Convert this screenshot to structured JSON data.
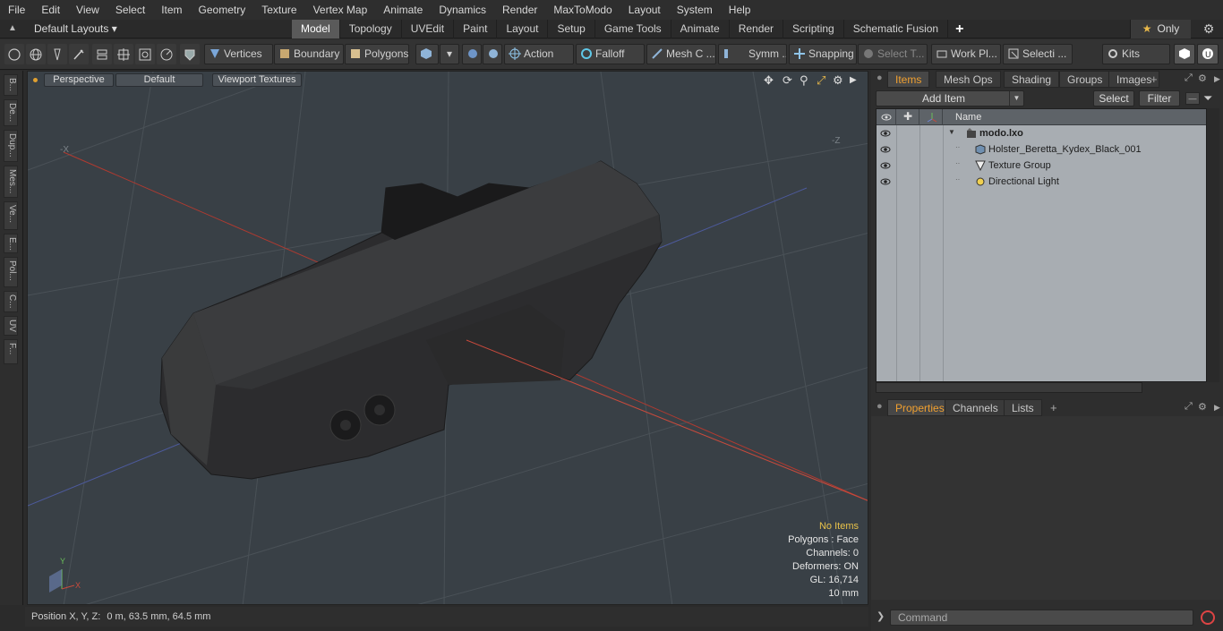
{
  "menu": [
    "File",
    "Edit",
    "View",
    "Select",
    "Item",
    "Geometry",
    "Texture",
    "Vertex Map",
    "Animate",
    "Dynamics",
    "Render",
    "MaxToModo",
    "Layout",
    "System",
    "Help"
  ],
  "layoutbar": {
    "layouts_label": "Default Layouts",
    "tabs": [
      "Model",
      "Topology",
      "UVEdit",
      "Paint",
      "Layout",
      "Setup",
      "Game Tools",
      "Animate",
      "Render",
      "Scripting",
      "Schematic Fusion"
    ],
    "active_tab": "Model",
    "only_label": "Only"
  },
  "toolbar": {
    "vertices": "Vertices",
    "boundary": "Boundary",
    "polygons": "Polygons",
    "action": "Action",
    "falloff": "Falloff",
    "mesh_c": "Mesh C ...",
    "symm": "Symm ...",
    "snapping": "Snapping",
    "select_t": "Select T...",
    "work_pl": "Work Pl...",
    "selecti": "Selecti ...",
    "kits": "Kits"
  },
  "leftstrip": [
    "B...",
    "De...",
    "Dup...",
    "Mes...",
    "Ve...",
    "E...",
    "Pol...",
    "C...",
    "UV",
    "F..."
  ],
  "viewport": {
    "perspective": "Perspective",
    "default": "Default",
    "textures": "Viewport Textures",
    "axis_neg_x": "-X",
    "axis_neg_z": "-Z",
    "stats": {
      "no_items": "No Items",
      "polygons": "Polygons : Face",
      "channels": "Channels: 0",
      "deformers": "Deformers: ON",
      "gl": "GL: 16,714",
      "scale": "10 mm"
    },
    "gizmo_y": "Y",
    "gizmo_x": "X"
  },
  "status": {
    "label": "Position X, Y, Z:",
    "value": "0 m, 63.5 mm, 64.5 mm"
  },
  "items_panel": {
    "tabs": [
      "Items",
      "Mesh Ops",
      "Shading",
      "Groups",
      "Images"
    ],
    "active_tab": "Items",
    "add_item": "Add Item",
    "select": "Select",
    "filter": "Filter",
    "col_name": "Name",
    "rows": [
      {
        "label": "modo.lxo",
        "icon": "scene-icon"
      },
      {
        "label": "Holster_Beretta_Kydex_Black_001",
        "icon": "mesh-icon"
      },
      {
        "label": "Texture Group",
        "icon": "texture-group-icon"
      },
      {
        "label": "Directional Light",
        "icon": "light-icon"
      }
    ]
  },
  "props_panel": {
    "tabs": [
      "Properties",
      "Channels",
      "Lists"
    ],
    "active_tab": "Properties"
  },
  "command": {
    "placeholder": "Command"
  },
  "colors": {
    "accent": "#f0a030",
    "viewport_bg": "#394046",
    "list_bg": "#a8adb2"
  }
}
